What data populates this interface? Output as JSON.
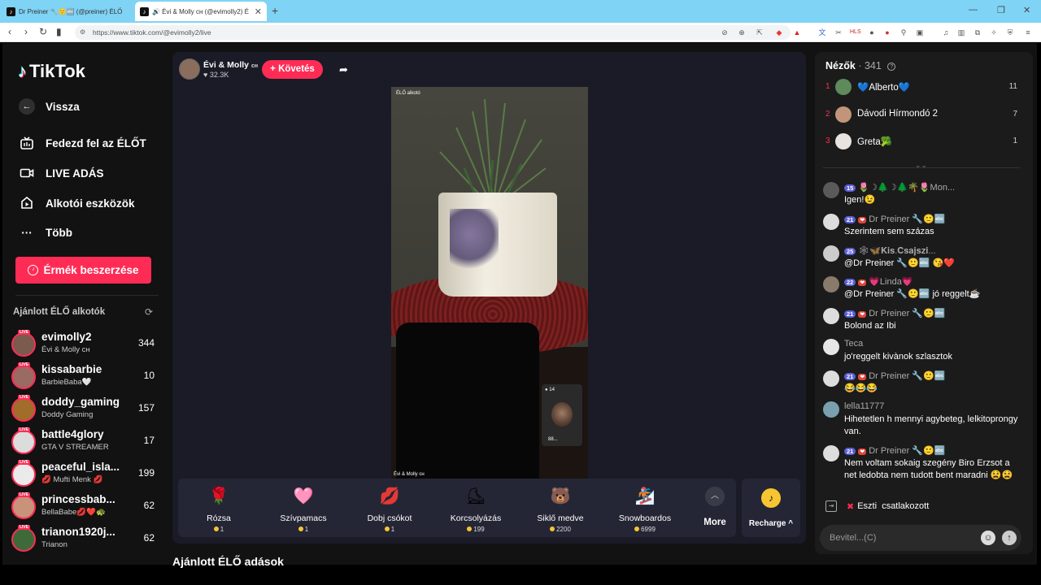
{
  "browser": {
    "tabs": [
      {
        "title": "Dr Preiner 🔧🙂🔤 (@preiner) ÉLŐ"
      },
      {
        "title": "🔊 Évi & Molly ᴄʜ (@evimolly2) É",
        "close": "✕"
      }
    ],
    "new_tab": "+",
    "url": "https://www.tiktok.com/@evimolly2/live"
  },
  "sidebar": {
    "logo": "TikTok",
    "back": "Vissza",
    "nav": [
      {
        "label": "Fedezd fel az ÉLŐT",
        "icon": "tv-icon"
      },
      {
        "label": "LIVE ADÁS",
        "icon": "camera-icon"
      },
      {
        "label": "Alkotói eszközök",
        "icon": "creator-tools-icon"
      },
      {
        "label": "Több",
        "icon": "more-dots-icon"
      }
    ],
    "coins_button": "Érmék beszerzése",
    "recommended_title": "Ajánlott ÉLŐ alkotók",
    "live_badge": "LIVE",
    "creators": [
      {
        "name": "evimolly2",
        "sub": "Évi & Molly ᴄʜ",
        "count": "344"
      },
      {
        "name": "kissabarbie",
        "sub": "BarbieBaba🤍",
        "count": "10"
      },
      {
        "name": "doddy_gaming",
        "sub": "Doddy Gaming",
        "count": "157"
      },
      {
        "name": "battle4glory",
        "sub": "GTA V STREAMER",
        "count": "17"
      },
      {
        "name": "peaceful_isla...",
        "sub": "💋 Mufti Menk 💋",
        "count": "199"
      },
      {
        "name": "princessbab...",
        "sub": "BellaBabe💋❤️🐢",
        "count": "62"
      },
      {
        "name": "trianon1920j...",
        "sub": "Trianon",
        "count": "62"
      }
    ]
  },
  "stream": {
    "host_name": "Évi & Molly",
    "host_suffix": "ᴄʜ",
    "likes": "32.3K",
    "follow": "+ Követés",
    "video_top_label": "ÉLŐ alkotó",
    "video_bottom_label": "Évi & Molly ᴄʜ",
    "pip_count": "14",
    "pip_label": "88..."
  },
  "gifts": [
    {
      "name": "Rózsa",
      "price": "1",
      "icon": "rose-icon",
      "glyph": "🌹"
    },
    {
      "name": "Szívpamacs",
      "price": "1",
      "icon": "heart-puff-icon",
      "glyph": "🩷"
    },
    {
      "name": "Dobj csókot",
      "price": "1",
      "icon": "lips-icon",
      "glyph": "💋"
    },
    {
      "name": "Korcsolyázás",
      "price": "199",
      "icon": "skates-icon",
      "glyph": "⛸"
    },
    {
      "name": "Siklő medve",
      "price": "2200",
      "icon": "bear-icon",
      "glyph": "🐻"
    },
    {
      "name": "Snowboardos",
      "price": "6999",
      "icon": "snowboarder-icon",
      "glyph": "🏂"
    }
  ],
  "more_label": "More",
  "recharge_label": "Recharge ^",
  "recommended_live": "Ajánlott ÉLŐ adások",
  "viewers": {
    "title": "Nézők",
    "count": "· 341",
    "top": [
      {
        "rank": "1",
        "name": "💙Alberto💙",
        "count": "11"
      },
      {
        "rank": "2",
        "name": "Dávodi Hírmondó 2",
        "count": "7"
      },
      {
        "rank": "3",
        "name": "Greta🥦",
        "count": "1"
      }
    ]
  },
  "chat": [
    {
      "level": "15",
      "badge": "",
      "user": "🌷☽🌲☽🌲🌴🌷Mon...",
      "text": "Igen!😉"
    },
    {
      "level": "21",
      "badge": "❤",
      "user": "Dr Preiner 🔧🙂🔤",
      "text": "Szerintem sem százas"
    },
    {
      "level": "25",
      "badge": "",
      "user": "🕸🦋𝐊𝐢𝐬.𝐂𝐬𝐚𝐣𝐬𝐳𝐢...",
      "text": "@Dr Preiner 🔧🙂🔤 😘❤️"
    },
    {
      "level": "22",
      "badge": "❤",
      "user": "💗Linda💗",
      "text": "@Dr Preiner 🔧🙂🔤 jó reggelt☕"
    },
    {
      "level": "21",
      "badge": "❤",
      "user": "Dr Preiner 🔧🙂🔤",
      "text": "Bolond az Ibi"
    },
    {
      "level": "",
      "badge": "",
      "user": "Teca",
      "text": "jo'reggelt kivànok szlasztok"
    },
    {
      "level": "21",
      "badge": "❤",
      "user": "Dr Preiner 🔧🙂🔤",
      "text": "😂😂😂"
    },
    {
      "level": "",
      "badge": "",
      "user": "lella11777",
      "text": "Hihetetlen h mennyi agybeteg, lelkitoprongy van."
    },
    {
      "level": "21",
      "badge": "❤",
      "user": "Dr Preiner 🔧🙂🔤",
      "text": "Nem voltam sokaig szegény Biro Erzsot a net ledobta nem tudott bent maradni 😫😫"
    }
  ],
  "join": {
    "user": "Eszti",
    "action": "csatlakozott"
  },
  "input_placeholder": "Bevitel...(C)"
}
